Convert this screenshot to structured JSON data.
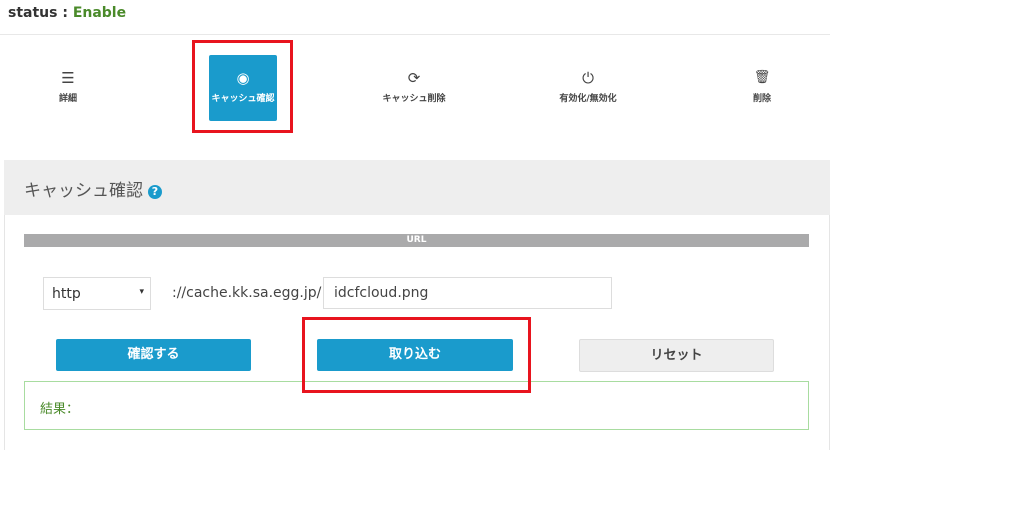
{
  "status": {
    "label": "status : ",
    "value": "Enable"
  },
  "toolbar": [
    {
      "label": "詳細",
      "icon": "server-icon",
      "glyph": "☰"
    },
    {
      "label": "キャッシュ確認",
      "icon": "eye-icon",
      "glyph": "◉"
    },
    {
      "label": "キャッシュ削除",
      "icon": "refresh-icon",
      "glyph": "⟳"
    },
    {
      "label": "有効化/無効化",
      "icon": "power-icon",
      "glyph": "⏻"
    },
    {
      "label": "削除",
      "icon": "trash-icon",
      "glyph": "🗑"
    }
  ],
  "panel": {
    "title": "キャッシュ確認",
    "help": "?",
    "url_header": "URL",
    "scheme": "http",
    "caret": "▾",
    "prefix": "://cache.kk.sa.egg.jp/",
    "filename": "idcfcloud.png",
    "buttons": {
      "confirm": "確認する",
      "import": "取り込む",
      "reset": "リセット"
    },
    "result_label": "結果："
  },
  "colors": {
    "accent": "#1a9bcc",
    "highlight": "#e8141e",
    "status": "#4a8a2a"
  }
}
